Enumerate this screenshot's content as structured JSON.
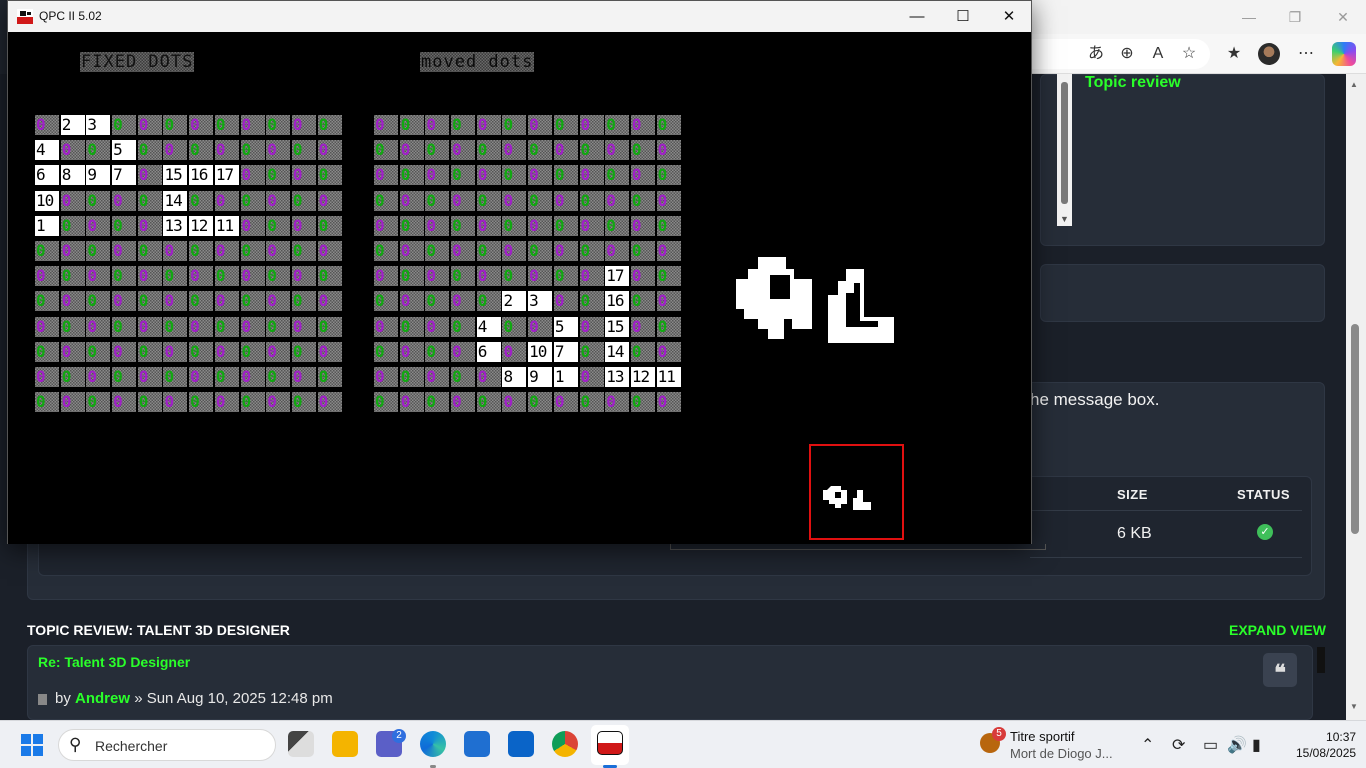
{
  "browser": {
    "toolbar_icons": [
      "read-aloud-icon",
      "zoom-icon",
      "text-size-icon",
      "favorite-star-icon",
      "favorites-icon",
      "avatar",
      "more-icon",
      "copilot-icon"
    ],
    "topic_review_heading": "Topic review",
    "message_hint": "he message box.",
    "table_headers": {
      "size": "SIZE",
      "status": "STATUS"
    },
    "attachment": {
      "size": "6 KB",
      "status": "ok"
    },
    "review_section_title": "TOPIC REVIEW: TALENT 3D DESIGNER",
    "expand_view": "EXPAND VIEW",
    "post": {
      "title": "Re: Talent 3D Designer",
      "by": "by",
      "author": "Andrew",
      "date": "» Sun Aug 10, 2025 12:48 pm"
    },
    "quote_glyph": "❝"
  },
  "qpc": {
    "title": "QPC II 5.02",
    "labels": {
      "fixed": "FIXED DOTS",
      "moved": "moved dots"
    },
    "fixed_grid": [
      [
        "0",
        "2",
        "3",
        "0",
        "0",
        "0",
        "0",
        "0",
        "0",
        "0",
        "0",
        "0"
      ],
      [
        "4",
        "0",
        "0",
        "5",
        "0",
        "0",
        "0",
        "0",
        "0",
        "0",
        "0",
        "0"
      ],
      [
        "6",
        "8",
        "9",
        "7",
        "0",
        "15",
        "16",
        "17",
        "0",
        "0",
        "0",
        "0"
      ],
      [
        "10",
        "0",
        "0",
        "0",
        "0",
        "14",
        "0",
        "0",
        "0",
        "0",
        "0",
        "0"
      ],
      [
        "1",
        "0",
        "0",
        "0",
        "0",
        "13",
        "12",
        "11",
        "0",
        "0",
        "0",
        "0"
      ],
      [
        "0",
        "0",
        "0",
        "0",
        "0",
        "0",
        "0",
        "0",
        "0",
        "0",
        "0",
        "0"
      ],
      [
        "0",
        "0",
        "0",
        "0",
        "0",
        "0",
        "0",
        "0",
        "0",
        "0",
        "0",
        "0"
      ],
      [
        "0",
        "0",
        "0",
        "0",
        "0",
        "0",
        "0",
        "0",
        "0",
        "0",
        "0",
        "0"
      ],
      [
        "0",
        "0",
        "0",
        "0",
        "0",
        "0",
        "0",
        "0",
        "0",
        "0",
        "0",
        "0"
      ],
      [
        "0",
        "0",
        "0",
        "0",
        "0",
        "0",
        "0",
        "0",
        "0",
        "0",
        "0",
        "0"
      ],
      [
        "0",
        "0",
        "0",
        "0",
        "0",
        "0",
        "0",
        "0",
        "0",
        "0",
        "0",
        "0"
      ],
      [
        "0",
        "0",
        "0",
        "0",
        "0",
        "0",
        "0",
        "0",
        "0",
        "0",
        "0",
        "0"
      ]
    ],
    "moved_grid": [
      [
        "0",
        "0",
        "0",
        "0",
        "0",
        "0",
        "0",
        "0",
        "0",
        "0",
        "0",
        "0"
      ],
      [
        "0",
        "0",
        "0",
        "0",
        "0",
        "0",
        "0",
        "0",
        "0",
        "0",
        "0",
        "0"
      ],
      [
        "0",
        "0",
        "0",
        "0",
        "0",
        "0",
        "0",
        "0",
        "0",
        "0",
        "0",
        "0"
      ],
      [
        "0",
        "0",
        "0",
        "0",
        "0",
        "0",
        "0",
        "0",
        "0",
        "0",
        "0",
        "0"
      ],
      [
        "0",
        "0",
        "0",
        "0",
        "0",
        "0",
        "0",
        "0",
        "0",
        "0",
        "0",
        "0"
      ],
      [
        "0",
        "0",
        "0",
        "0",
        "0",
        "0",
        "0",
        "0",
        "0",
        "0",
        "0",
        "0"
      ],
      [
        "0",
        "0",
        "0",
        "0",
        "0",
        "0",
        "0",
        "0",
        "0",
        "17",
        "0",
        "0"
      ],
      [
        "0",
        "0",
        "0",
        "0",
        "0",
        "2",
        "3",
        "0",
        "0",
        "16",
        "0",
        "0"
      ],
      [
        "0",
        "0",
        "0",
        "0",
        "4",
        "0",
        "0",
        "5",
        "0",
        "15",
        "0",
        "0"
      ],
      [
        "0",
        "0",
        "0",
        "0",
        "6",
        "0",
        "10",
        "7",
        "0",
        "14",
        "0",
        "0"
      ],
      [
        "0",
        "0",
        "0",
        "0",
        "0",
        "8",
        "9",
        "1",
        "0",
        "13",
        "12",
        "11"
      ],
      [
        "0",
        "0",
        "0",
        "0",
        "0",
        "0",
        "0",
        "0",
        "0",
        "0",
        "0",
        "0"
      ]
    ]
  },
  "taskbar": {
    "search_placeholder": "Rechercher",
    "teams_badge": "2",
    "news_badge": "5",
    "news_line1": "Titre sportif",
    "news_line2": "Mort de Diogo J...",
    "time": "10:37",
    "date": "15/08/2025"
  },
  "colors": {
    "green_accent": "#2aff2a",
    "zero_purple": "#a020c8",
    "zero_green": "#11a811",
    "red_box": "#e01010"
  }
}
